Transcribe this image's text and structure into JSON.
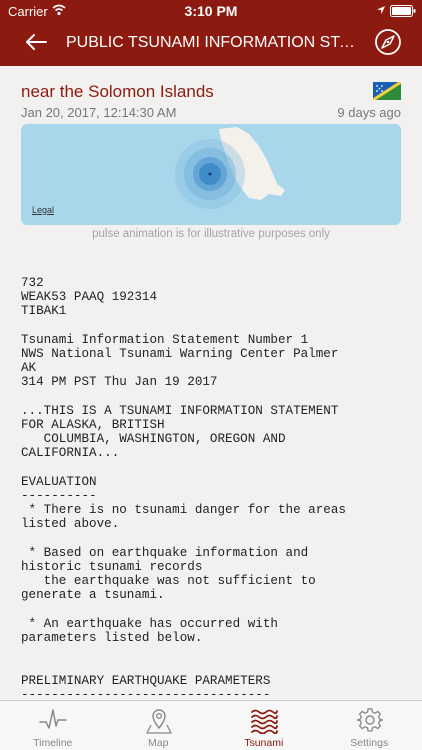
{
  "status_bar": {
    "carrier": "Carrier",
    "time": "3:10 PM"
  },
  "nav": {
    "title": "PUBLIC TSUNAMI INFORMATION STATEMENT",
    "back_icon": "back-arrow-icon",
    "right_icon": "compass-icon"
  },
  "event": {
    "location": "near the Solomon Islands",
    "datetime": "Jan 20, 2017, 12:14:30 AM",
    "age": "9 days ago",
    "flag_icon": "solomon-islands-flag-icon"
  },
  "map": {
    "legal_label": "Legal",
    "pulse_note": "pulse animation is for illustrative purposes only"
  },
  "bulletin": {
    "text": "732\nWEAK53 PAAQ 192314\nTIBAK1\n\nTsunami Information Statement Number 1\nNWS National Tsunami Warning Center Palmer\nAK\n314 PM PST Thu Jan 19 2017\n\n...THIS IS A TSUNAMI INFORMATION STATEMENT\nFOR ALASKA, BRITISH\n   COLUMBIA, WASHINGTON, OREGON AND\nCALIFORNIA...\n\nEVALUATION\n----------\n * There is no tsunami danger for the areas\nlisted above.\n\n * Based on earthquake information and\nhistoric tsunami records\n   the earthquake was not sufficient to\ngenerate a tsunami.\n\n * An earthquake has occurred with\nparameters listed below.\n\n\nPRELIMINARY EARTHQUAKE PARAMETERS\n---------------------------------"
  },
  "tabs": [
    {
      "label": "Timeline",
      "icon": "timeline-pulse-icon",
      "active": false
    },
    {
      "label": "Map",
      "icon": "map-pin-icon",
      "active": false
    },
    {
      "label": "Tsunami",
      "icon": "tsunami-waves-icon",
      "active": true
    },
    {
      "label": "Settings",
      "icon": "gear-icon",
      "active": false
    }
  ],
  "colors": {
    "brand": "#8c1a10",
    "tab_inactive": "#888888",
    "map_water": "#a8d7ec"
  }
}
